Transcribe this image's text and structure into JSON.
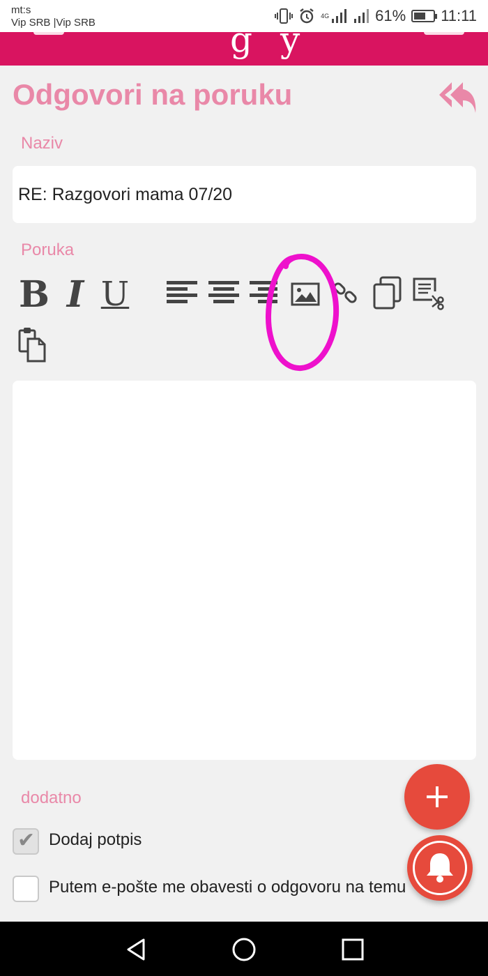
{
  "status_bar": {
    "carrier_line1": "mt:s",
    "carrier_line2": "Vip SRB |Vip SRB",
    "network_type": "4G",
    "battery_percent": "61%",
    "battery_level": 0.61,
    "time": "11:11",
    "icons": [
      "vibrate-icon",
      "alarm-icon",
      "signal-icon",
      "signal-icon",
      "battery-icon"
    ]
  },
  "header": {
    "brand_color": "#d91460"
  },
  "page": {
    "title": "Odgovori na poruku",
    "reply_icon": "reply-all-icon"
  },
  "form": {
    "subject_label": "Naziv",
    "subject_value": "RE: Razgovori mama 07/20",
    "message_label": "Poruka",
    "toolbar": {
      "bold": "B",
      "italic": "I",
      "underline": "U",
      "icons": [
        "align-left-icon",
        "align-center-icon",
        "align-right-icon",
        "image-icon",
        "link-icon",
        "copy-icon",
        "cut-icon",
        "paste-icon"
      ]
    },
    "extra_label": "dodatno",
    "options": [
      {
        "label": "Dodaj potpis",
        "checked": true
      },
      {
        "label": "Putem e-pošte me obavesti o odgovoru na temu",
        "checked": false
      }
    ]
  },
  "annotation": {
    "color": "#ee11cc",
    "target": "image-icon"
  },
  "fabs": {
    "add_icon": "plus-icon",
    "notify_icon": "bell-icon",
    "color": "#e64a3c"
  },
  "navigation": {
    "icons": [
      "back-icon",
      "home-icon",
      "recents-icon"
    ]
  }
}
